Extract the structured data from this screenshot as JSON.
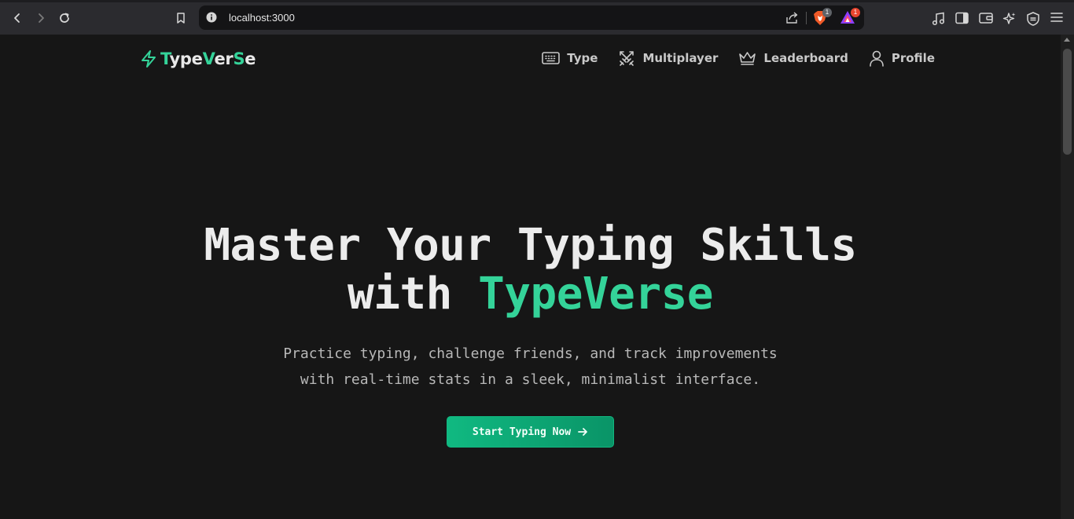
{
  "browser": {
    "url": "localhost:3000",
    "shields_badge": "1",
    "rewards_badge": "1"
  },
  "site": {
    "logo": {
      "parts": [
        "T",
        "ype",
        "V",
        "er",
        "S",
        "e"
      ]
    },
    "nav": [
      {
        "label": "Type",
        "icon": "keyboard-icon"
      },
      {
        "label": "Multiplayer",
        "icon": "swords-icon"
      },
      {
        "label": "Leaderboard",
        "icon": "crown-icon"
      },
      {
        "label": "Profile",
        "icon": "user-icon"
      }
    ]
  },
  "hero": {
    "title_line1": "Master Your Typing Skills",
    "title_line2_prefix": "with ",
    "title_line2_accent": "TypeVerse",
    "subtitle_line1": "Practice typing, challenge friends, and track improvements",
    "subtitle_line2": "with real-time stats in a sleek, minimalist interface.",
    "cta_label": "Start Typing Now",
    "cta_icon": "arrow-right-icon"
  },
  "colors": {
    "accent": "#34d399",
    "button": "#10b981",
    "background": "#161616",
    "chrome": "#2b2b2f"
  }
}
